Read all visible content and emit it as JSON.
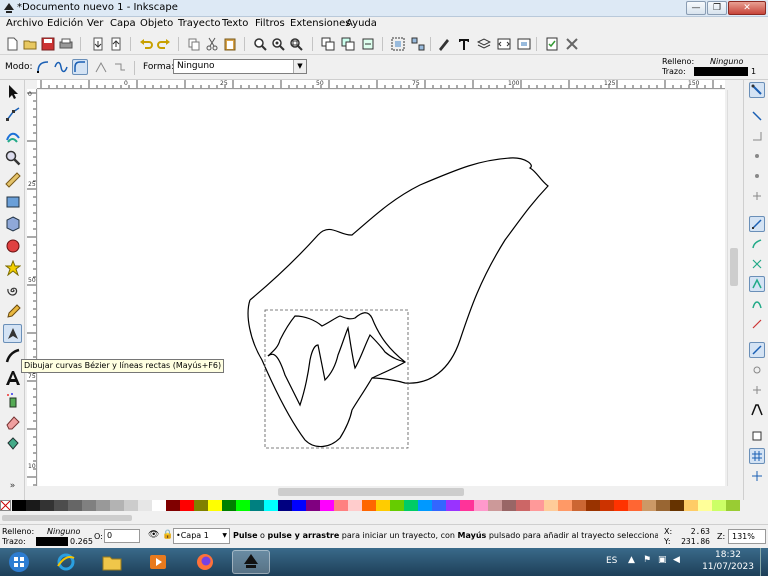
{
  "window": {
    "title": "*Documento nuevo 1 - Inkscape",
    "minimize": "—",
    "maximize": "❐",
    "close": "✕"
  },
  "menu": [
    "Archivo",
    "Edición",
    "Ver",
    "Capa",
    "Objeto",
    "Trayecto",
    "Texto",
    "Filtros",
    "Extensiones",
    "Ayuda"
  ],
  "commands": [
    "new-doc-icon",
    "open-icon",
    "save-icon",
    "print-icon",
    "import-icon",
    "export-icon",
    "undo-icon",
    "redo-icon",
    "copy-icon",
    "cut-icon",
    "paste-icon",
    "zoom-selection-icon",
    "zoom-drawing-icon",
    "zoom-page-icon",
    "duplicate-icon",
    "clone-icon",
    "unlink-clone-icon",
    "group-icon",
    "ungroup-icon",
    "fill-stroke-icon",
    "text-font-icon",
    "layers-icon",
    "xml-editor-icon",
    "align-icon",
    "document-properties-icon",
    "preferences-icon"
  ],
  "controls": {
    "mode_label": "Modo:",
    "shape_label": "Forma:",
    "shape_value": "Ninguno",
    "fill_label": "Relleno:",
    "fill_value": "Ninguno",
    "stroke_label": "Trazo:",
    "stroke_width": "1"
  },
  "tooltip": "Dibujar curvas Bézier y líneas rectas (Mayús+F6)",
  "ruler": {
    "h_ticks": [
      "0",
      "25",
      "50",
      "75",
      "100",
      "125",
      "150",
      "175"
    ],
    "v_ticks": [
      "0",
      "25",
      "50",
      "75",
      "100",
      "125"
    ]
  },
  "status": {
    "fill_label": "Relleno:",
    "fill_value": "Ninguno",
    "stroke_label": "Trazo:",
    "stroke_width": "0.265",
    "opacity_label": "O:",
    "opacity_value": "0",
    "layer": "Capa 1",
    "message_b1": "Pulse",
    "message_t1": " o ",
    "message_b2": "pulse y arrastre",
    "message_t2": " para iniciar un trayecto, con ",
    "message_b3": "Mayús",
    "message_t3": " pulsado para añadir al trayecto seleccionado. ...",
    "x_label": "X:",
    "x_value": "2.63",
    "y_label": "Y:",
    "y_value": "231.86",
    "z_label": "Z:",
    "zoom_value": "131%"
  },
  "taskbar": {
    "lang": "ES",
    "time": "18:32",
    "date": "11/07/2023"
  },
  "palette": [
    "#000000",
    "#1a1a1a",
    "#333333",
    "#4d4d4d",
    "#666666",
    "#808080",
    "#999999",
    "#b3b3b3",
    "#cccccc",
    "#e6e6e6",
    "#ffffff",
    "#800000",
    "#ff0000",
    "#808000",
    "#ffff00",
    "#008000",
    "#00ff00",
    "#008080",
    "#00ffff",
    "#000080",
    "#0000ff",
    "#800080",
    "#ff00ff",
    "#ff8080",
    "#ffcccc",
    "#ff6600",
    "#ffcc00",
    "#66cc00",
    "#00cc66",
    "#0099ff",
    "#3366ff",
    "#9933ff",
    "#ff3399",
    "#ff99cc",
    "#cc9999",
    "#996666",
    "#cc6666",
    "#ff9999",
    "#ffcc99",
    "#ff9966",
    "#cc6633",
    "#993300",
    "#cc3300",
    "#ff3300",
    "#ff6633",
    "#cc9966",
    "#996633",
    "#663300",
    "#ffcc66",
    "#ffff99",
    "#ccff66",
    "#99cc33"
  ]
}
